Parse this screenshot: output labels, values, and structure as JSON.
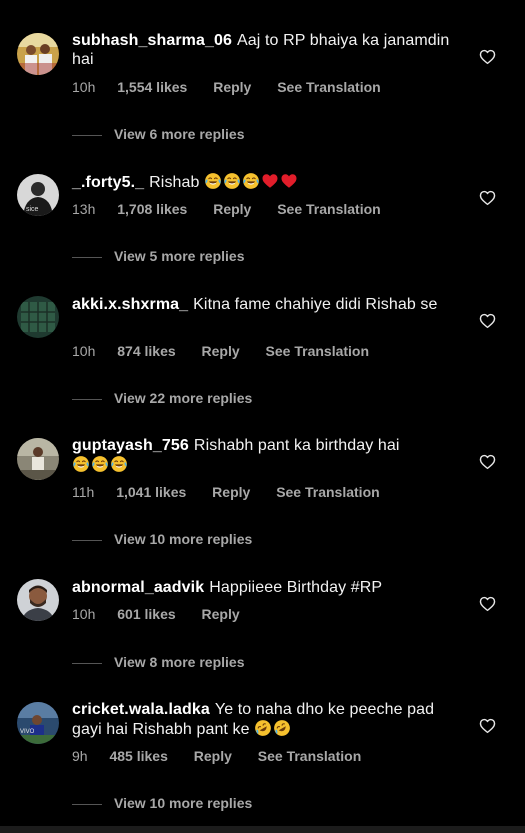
{
  "colors": {
    "background": "#000000",
    "primary_text": "#f5f5f5",
    "secondary_text": "#a8a8a8",
    "heart_red": "#e11d2a",
    "emoji_yellow": "#f6c12e"
  },
  "comments": [
    {
      "username": "subhash_sharma_06",
      "text": "Aaj to RP bhaiya ka janamdin hai",
      "time": "10h",
      "likes": "1,554 likes",
      "reply": "Reply",
      "translation": "See Translation",
      "view_more": "View 6 more replies"
    },
    {
      "username": "_.forty5._",
      "text": "Rishab",
      "emojis": [
        "laugh-cry",
        "laugh-cry",
        "laugh-cry",
        "red-heart",
        "red-heart"
      ],
      "time": "13h",
      "likes": "1,708 likes",
      "reply": "Reply",
      "translation": "See Translation",
      "view_more": "View 5 more replies"
    },
    {
      "username": "akki.x.shxrma_",
      "text": "Kitna fame chahiye didi Rishab se",
      "time": "10h",
      "likes": "874 likes",
      "reply": "Reply",
      "translation": "See Translation",
      "view_more": "View 22 more replies"
    },
    {
      "username": "guptayash_756",
      "text": "Rishabh pant ka birthday hai",
      "emojis": [
        "laugh-cry",
        "laugh-cry",
        "laugh-cry"
      ],
      "time": "11h",
      "likes": "1,041 likes",
      "reply": "Reply",
      "translation": "See Translation",
      "view_more": "View 10 more replies"
    },
    {
      "username": "abnormal_aadvik",
      "text": "Happiieee Birthday #RP",
      "time": "10h",
      "likes": "601 likes",
      "reply": "Reply",
      "view_more": "View 8 more replies"
    },
    {
      "username": "cricket.wala.ladka",
      "text": "Ye to naha dho ke peeche pad gayi hai Rishabh pant ke",
      "emojis": [
        "rofl",
        "rofl"
      ],
      "time": "9h",
      "likes": "485 likes",
      "reply": "Reply",
      "translation": "See Translation",
      "view_more": "View 10 more replies"
    }
  ]
}
